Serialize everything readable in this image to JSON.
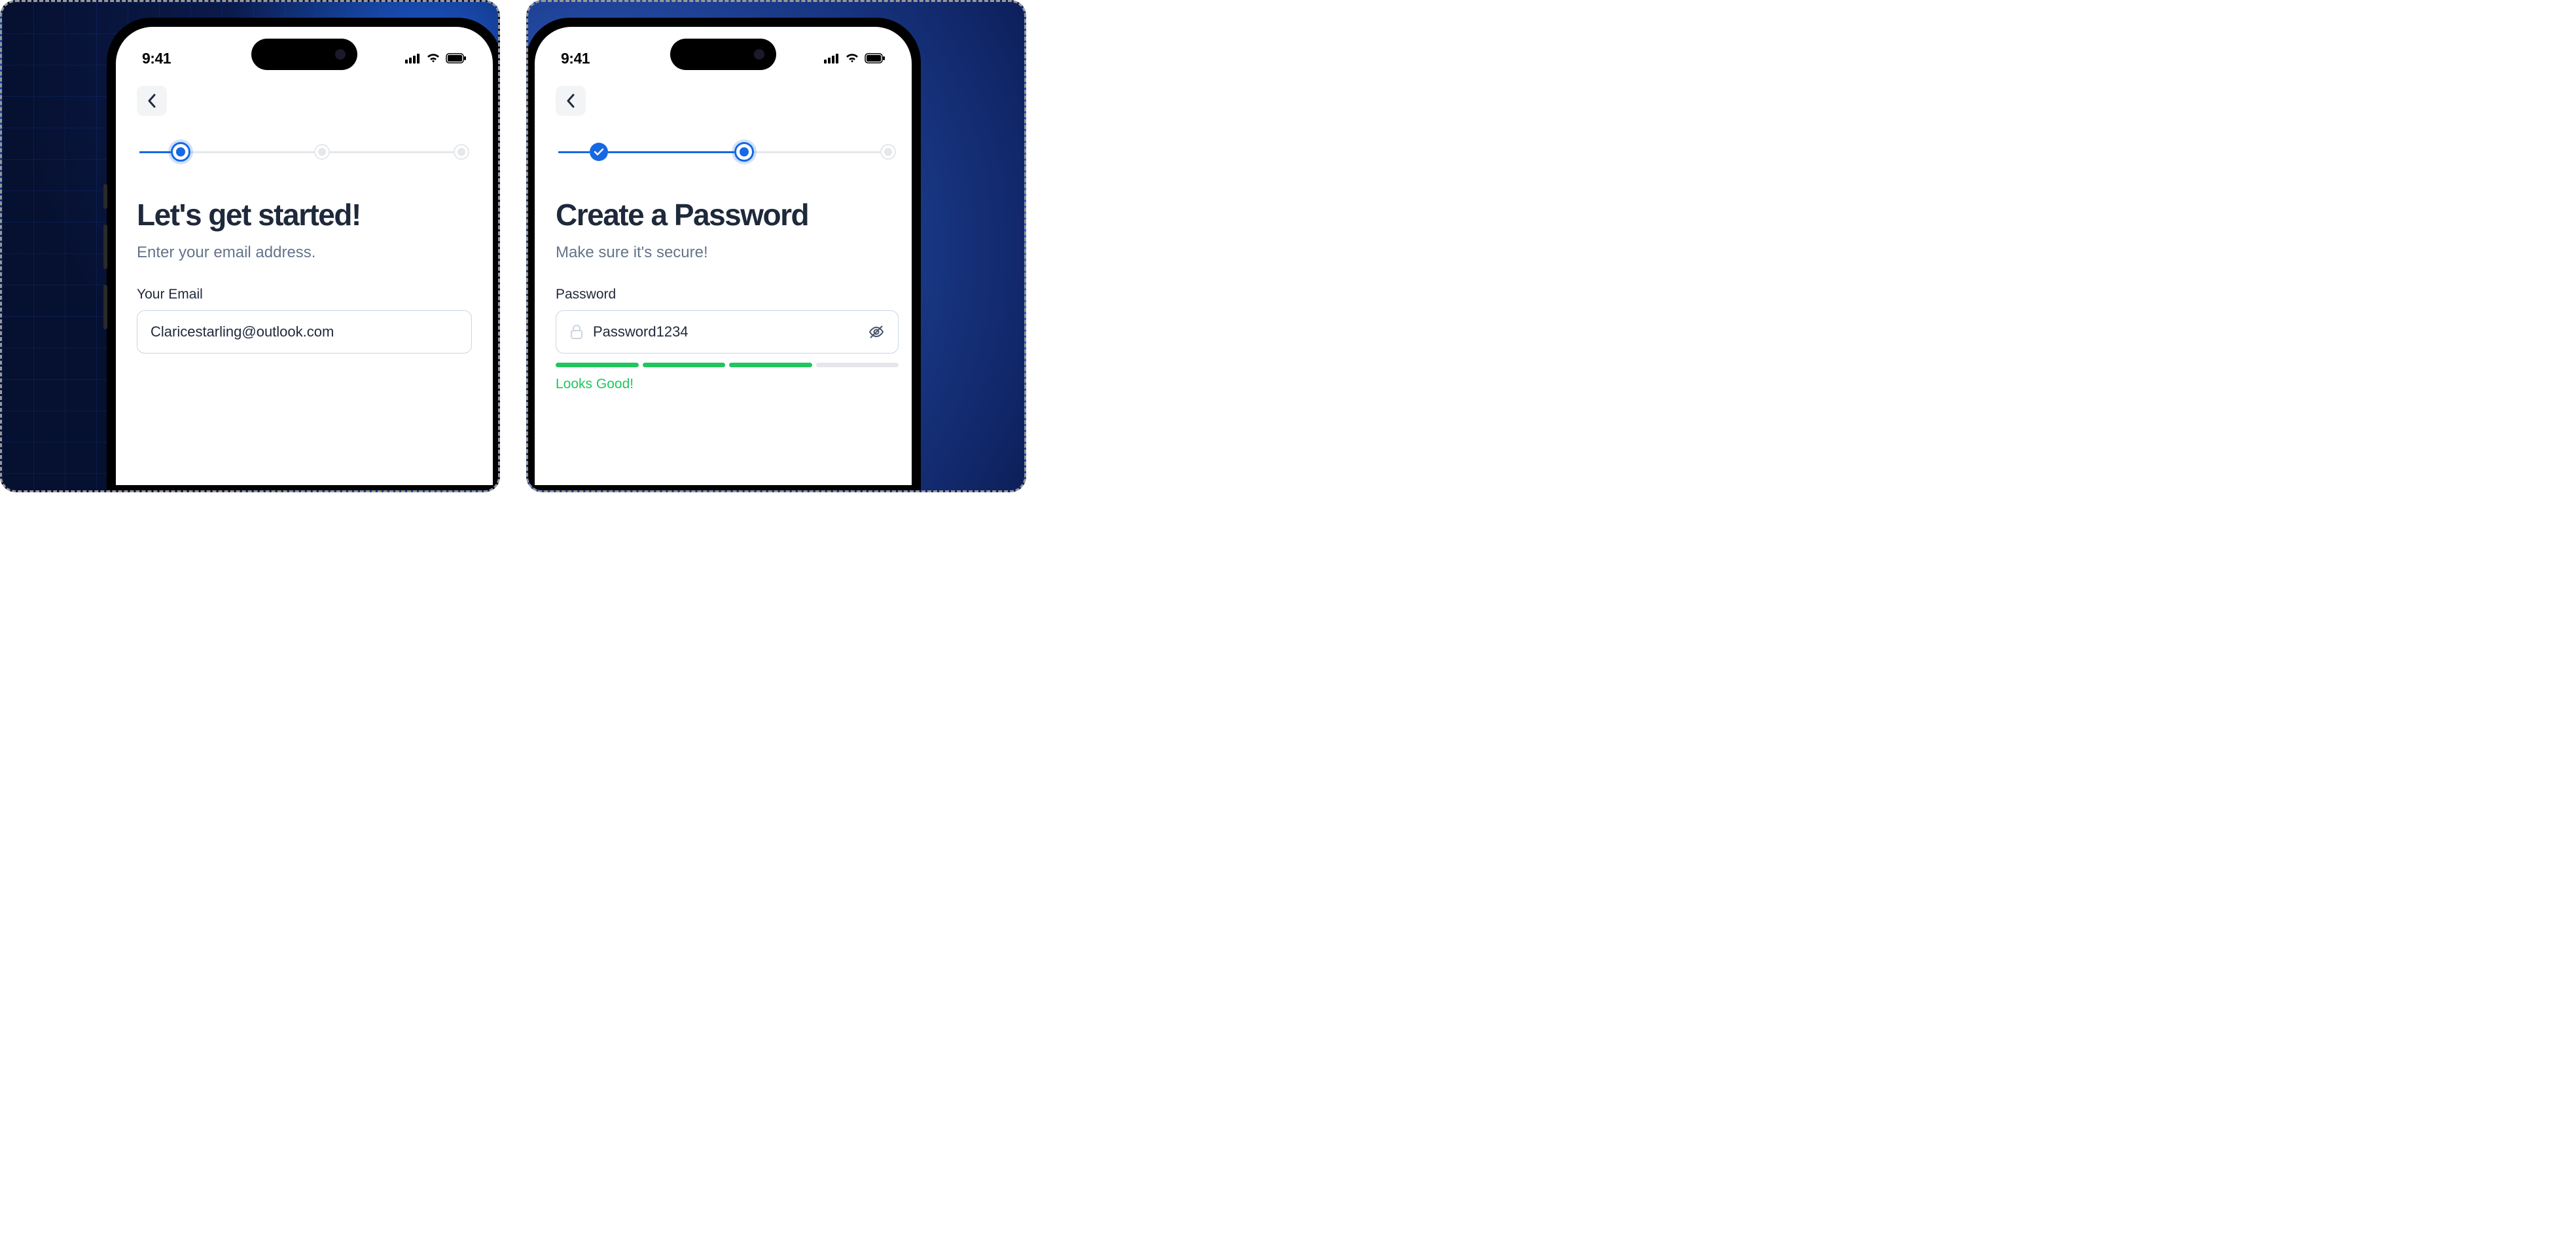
{
  "status": {
    "time": "9:41"
  },
  "screen1": {
    "heading": "Let's get started!",
    "subheading": "Enter your email address.",
    "field_label": "Your Email",
    "field_value": "Claricestarling@outlook.com",
    "stepper": {
      "current": 1,
      "total": 3
    }
  },
  "screen2": {
    "heading": "Create a Password",
    "subheading": "Make sure it's secure!",
    "field_label": "Password",
    "field_value": "Password1234",
    "strength_text": "Looks Good!",
    "strength_filled": 3,
    "strength_total": 4,
    "stepper": {
      "completed": 1,
      "current": 2,
      "total": 3
    }
  }
}
